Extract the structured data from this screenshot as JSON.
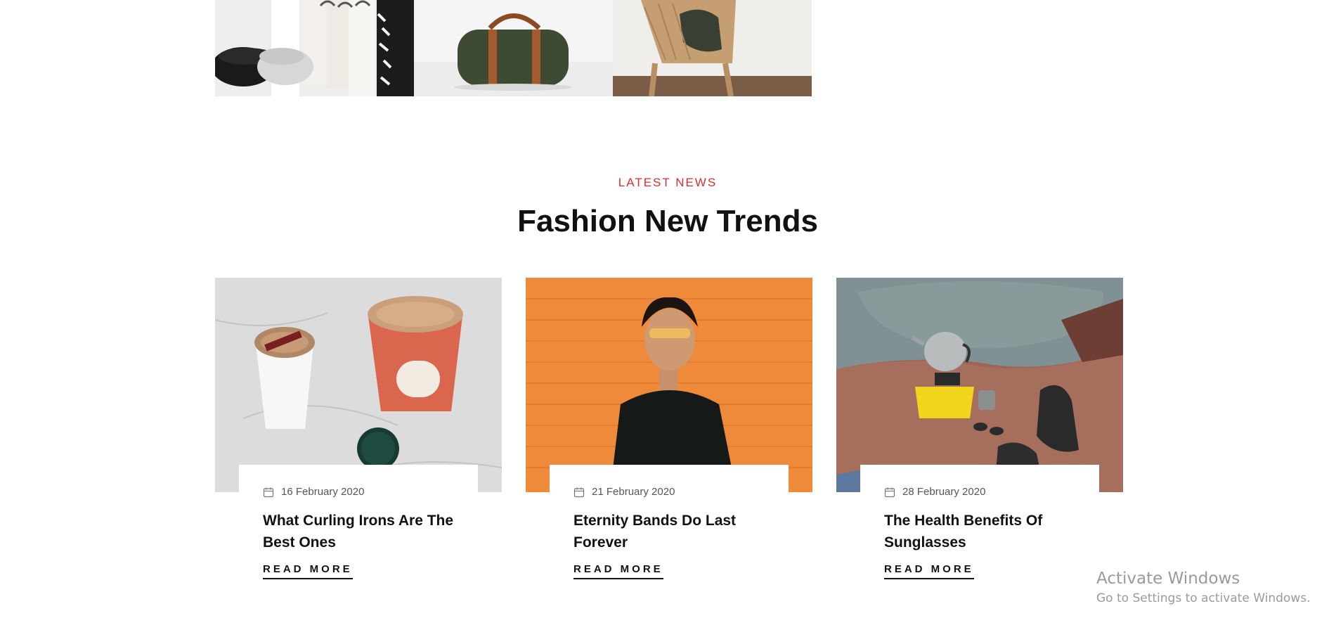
{
  "section": {
    "tag": "LATEST NEWS",
    "title": "Fashion New Trends"
  },
  "posts": [
    {
      "date": "16 February 2020",
      "title": "What Curling Irons Are The Best Ones",
      "read_more": "READ MORE"
    },
    {
      "date": "21 February 2020",
      "title": "Eternity Bands Do Last Forever",
      "read_more": "READ MORE"
    },
    {
      "date": "28 February 2020",
      "title": "The Health Benefits Of Sunglasses",
      "read_more": "READ MORE"
    }
  ],
  "watermark": {
    "line1": "Activate Windows",
    "line2": "Go to Settings to activate Windows."
  },
  "colors": {
    "accent": "#e22a2a",
    "text": "#111111",
    "meta": "#555555"
  },
  "icons": {
    "date": "calendar-icon"
  }
}
